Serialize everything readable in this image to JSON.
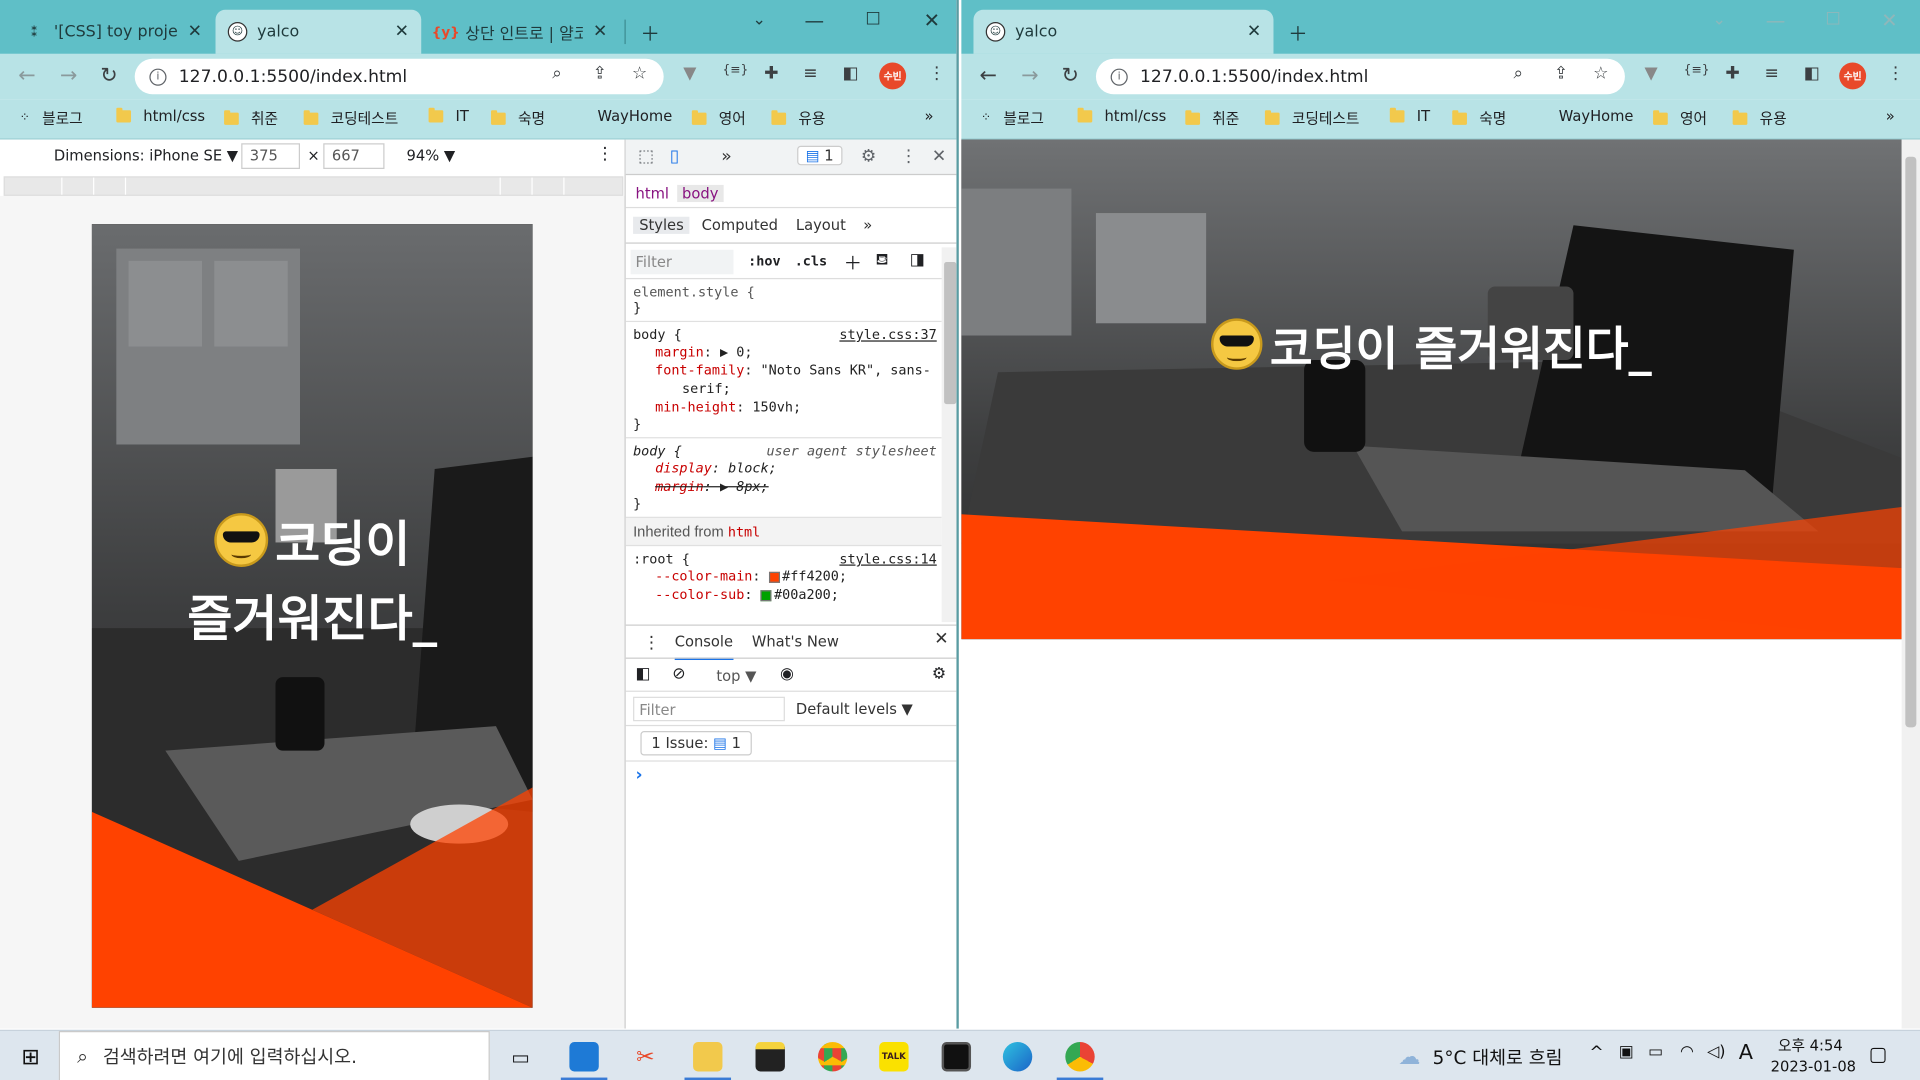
{
  "left_window": {
    "tabs": [
      {
        "title": "'[CSS] toy project",
        "favicon": "puzzle-icon"
      },
      {
        "title": "yalco",
        "favicon": "face-icon"
      },
      {
        "title": "상단 인트로 | 얄코",
        "favicon": "y-icon"
      }
    ],
    "url": "127.0.0.1:5500/index.html",
    "profile_label": "수빈",
    "device_toolbar": {
      "device": "Dimensions: iPhone SE ▼",
      "width": "375",
      "times": "×",
      "height": "667",
      "zoom": "94% ▼"
    },
    "headline_line1": "코딩이",
    "headline_line2": "즐거워진다_"
  },
  "bookmarks": [
    {
      "label": "블로그",
      "type": "apps"
    },
    {
      "label": "html/css",
      "type": "folder"
    },
    {
      "label": "취준",
      "type": "folder"
    },
    {
      "label": "코딩테스트",
      "type": "folder"
    },
    {
      "label": "IT",
      "type": "folder"
    },
    {
      "label": "숙명",
      "type": "folder"
    },
    {
      "label": "WayHome",
      "type": "plain"
    },
    {
      "label": "영어",
      "type": "folder"
    },
    {
      "label": "유용",
      "type": "folder"
    }
  ],
  "devtools": {
    "issues_badge": "1",
    "breadcrumb": [
      "html",
      "body"
    ],
    "subtabs": [
      "Styles",
      "Computed",
      "Layout",
      "»"
    ],
    "filter_placeholder": "Filter",
    "hov": ":hov",
    "cls": ".cls",
    "rules": {
      "element_style": "element.style {",
      "close": "}",
      "body_selector": "body {",
      "body_source": "style.css:37",
      "margin_prop": "margin",
      "margin_val": ": ▶ 0;",
      "font_prop": "font-family",
      "font_val": ": \"Noto Sans KR\", sans-",
      "font_val2": "serif;",
      "minh_prop": "min-height",
      "minh_val": ": 150vh;",
      "ua_selector": "body {",
      "ua_source": "user agent stylesheet",
      "display_prop": "display",
      "display_val": ": block;",
      "uamargin_prop": "margin",
      "uamargin_val": ": ▶ 8px;",
      "inherited_label": "Inherited from",
      "inherited_tag": "html",
      "root_selector": ":root {",
      "root_source": "style.css:14",
      "color_main_prop": "--color-main",
      "color_main_val": "#ff4200;",
      "color_sub_prop": "--color-sub",
      "color_sub_val": "#00a200;"
    },
    "console": {
      "tabs": [
        "Console",
        "What's New"
      ],
      "context": "top ▼",
      "filter_placeholder": "Filter",
      "levels": "Default levels ▼",
      "issue": "1 Issue:",
      "issue_count": "1",
      "prompt": "›"
    }
  },
  "right_window": {
    "tab_title": "yalco",
    "url": "127.0.0.1:5500/index.html",
    "profile_label": "수빈",
    "headline": "코딩이 즐거워진다_"
  },
  "taskbar": {
    "search_placeholder": "검색하려면 여기에 입력하십시오.",
    "weather": "5°C  대체로 흐림",
    "ime": "A",
    "ampm_time": "오후 4:54",
    "date": "2023-01-08"
  },
  "colors": {
    "main": "#ff4200",
    "sub": "#00a200",
    "tabbar": "#5fbfc7",
    "toolbar": "#b8e3e6"
  }
}
